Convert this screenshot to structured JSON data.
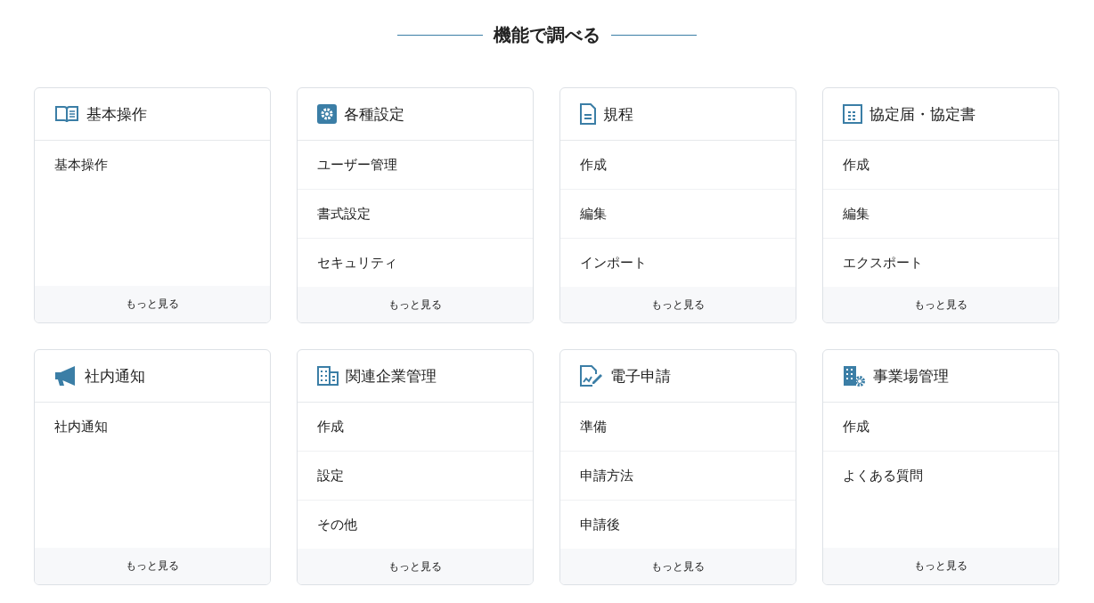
{
  "heading": "機能で調べる",
  "cards": [
    {
      "title": "基本操作",
      "items": [
        "基本操作"
      ],
      "more": "もっと見る"
    },
    {
      "title": "各種設定",
      "items": [
        "ユーザー管理",
        "書式設定",
        "セキュリティ"
      ],
      "more": "もっと見る"
    },
    {
      "title": "規程",
      "items": [
        "作成",
        "編集",
        "インポート"
      ],
      "more": "もっと見る"
    },
    {
      "title": "協定届・協定書",
      "items": [
        "作成",
        "編集",
        "エクスポート"
      ],
      "more": "もっと見る"
    },
    {
      "title": "社内通知",
      "items": [
        "社内通知"
      ],
      "more": "もっと見る"
    },
    {
      "title": "関連企業管理",
      "items": [
        "作成",
        "設定",
        "その他"
      ],
      "more": "もっと見る"
    },
    {
      "title": "電子申請",
      "items": [
        "準備",
        "申請方法",
        "申請後"
      ],
      "more": "もっと見る"
    },
    {
      "title": "事業場管理",
      "items": [
        "作成",
        "よくある質問"
      ],
      "more": "もっと見る"
    }
  ]
}
